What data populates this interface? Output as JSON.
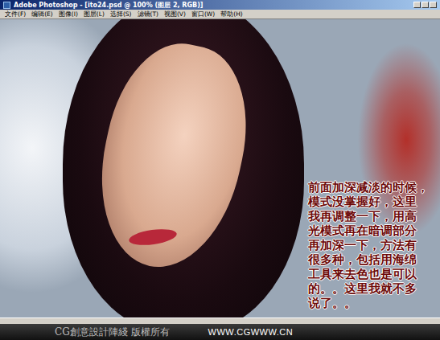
{
  "window": {
    "title": "Adobe Photoshop - [ito24.psd @ 100% (图层 2, RGB)]"
  },
  "menu": [
    "文件(F)",
    "编辑(E)",
    "图像(I)",
    "图层(L)",
    "选择(S)",
    "滤镜(T)",
    "视图(V)",
    "窗口(W)",
    "帮助(H)"
  ],
  "annotation": "前面加深减淡的时候，\n模式没掌握好，这里\n我再调整一下，用高\n光模式再在暗调部分\n再加深一下，方法有\n很多种，包括用海绵\n工具来去色也是可以\n的。。这里我就不多\n说了。。",
  "footer": {
    "copyright": "CG創意設計陣綫 版權所有",
    "url": "WWW.CGWWW.CN"
  }
}
